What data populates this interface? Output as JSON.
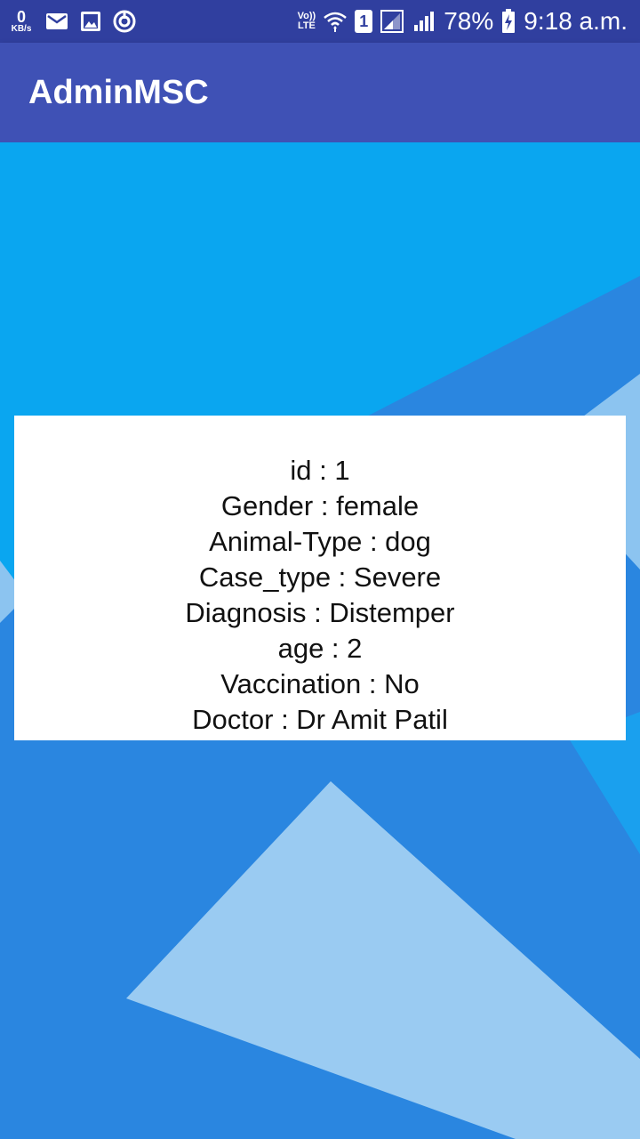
{
  "status_bar": {
    "net_speed_value": "0",
    "net_speed_unit": "KB/s",
    "volte_label_top": "Vo))",
    "volte_label_bottom": "LTE",
    "sim_label": "1",
    "battery_percent": "78%",
    "time": "9:18 a.m."
  },
  "app_bar": {
    "title": "AdminMSC"
  },
  "record": {
    "id_line": "id : 1",
    "gender_line": "Gender : female",
    "animal_type_line": "Animal-Type : dog",
    "case_type_line": "Case_type : Severe",
    "diagnosis_line": "Diagnosis : Distemper",
    "age_line": "age : 2",
    "vaccination_line": "Vaccination : No",
    "doctor_line": "Doctor : Dr Amit Patil"
  },
  "colors": {
    "status_bar": "#303f9f",
    "app_bar": "#3f51b5",
    "wallpaper_base": "#0aa6f0",
    "wallpaper_dark": "#2a86e0",
    "wallpaper_light": "#9acbf2"
  }
}
